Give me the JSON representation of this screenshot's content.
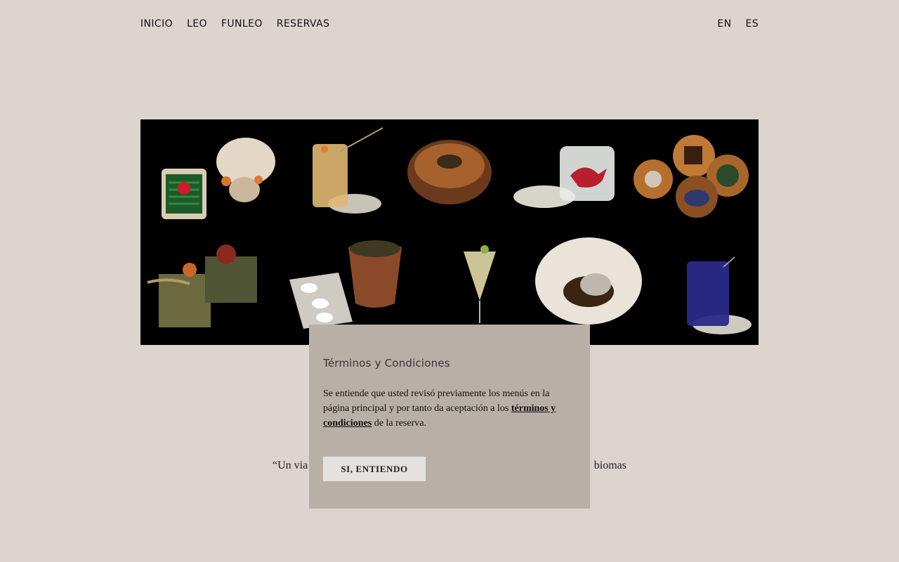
{
  "nav": {
    "items": [
      {
        "label": "INICIO"
      },
      {
        "label": "LEO"
      },
      {
        "label": "FUNLEO"
      },
      {
        "label": "RESERVAS"
      }
    ],
    "languages": [
      {
        "label": "EN"
      },
      {
        "label": "ES"
      }
    ]
  },
  "hero": {
    "dishes_row1": [
      "dish-plate-flowers",
      "cocktail-glass-amber",
      "wooden-bowl",
      "glass-red-bird",
      "wooden-boxes"
    ],
    "dishes_row2": [
      "ceramic-boxes",
      "clay-pot-spoons",
      "martini-glass",
      "white-bowl",
      "blue-drink-glass"
    ]
  },
  "quote": {
    "left": "“Un via",
    "right": "biomas"
  },
  "modal": {
    "title": "Términos y Condiciones",
    "text_before": "Se entiende que usted revisó previamente los menús en la página principal y por tanto da aceptación a los ",
    "link_label": "términos y condiciones",
    "text_after": " de la reserva.",
    "button_label": "SI, ENTIENDO"
  },
  "colors": {
    "background": "#dbd4cf",
    "modal_background": "#b8afa7",
    "button_background": "#e4e1de",
    "hero_background": "#000000"
  }
}
